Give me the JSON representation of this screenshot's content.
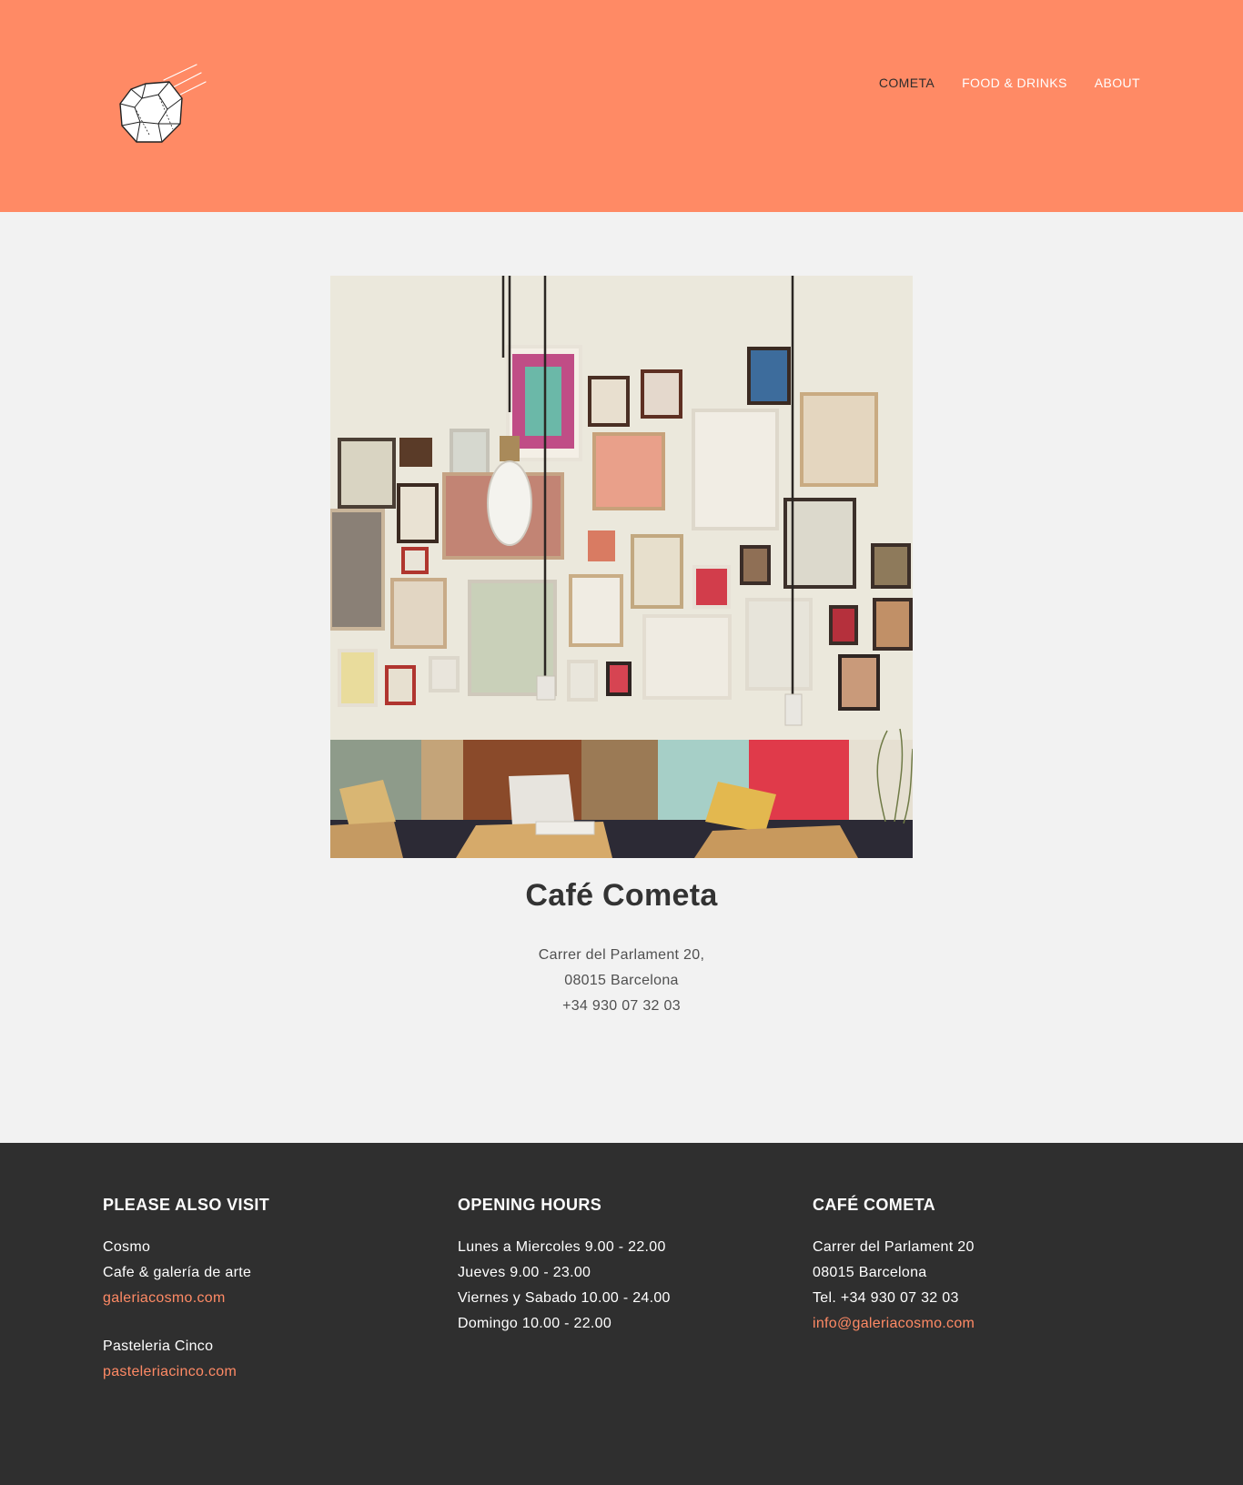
{
  "brand": {
    "logo_icon": "comet-icon",
    "accent": "#ff8a65",
    "dark": "#2f2f2f"
  },
  "nav": {
    "items": [
      {
        "label": "COMETA",
        "active": true
      },
      {
        "label": "FOOD & DRINKS",
        "active": false
      },
      {
        "label": "ABOUT",
        "active": false
      }
    ]
  },
  "venue": {
    "name": "Café Cometa",
    "address_line1": "Carrer del Parlament 20,",
    "address_line2": "08015 Barcelona",
    "phone": "+34 930 07 32 03"
  },
  "footer": {
    "visit": {
      "heading": "PLEASE ALSO VISIT",
      "place1_name": "Cosmo",
      "place1_desc": "Cafe & galería de arte",
      "place1_link": "galeriacosmo.com",
      "place2_name": "Pasteleria Cinco",
      "place2_link": "pasteleriacinco.com"
    },
    "hours": {
      "heading": "OPENING HOURS",
      "lines": [
        "Lunes a Miercoles 9.00 - 22.00",
        "Jueves 9.00 - 23.00",
        "Viernes y Sabado 10.00 - 24.00",
        "Domingo 10.00 - 22.00"
      ]
    },
    "contact": {
      "heading": "CAFÉ COMETA",
      "address_line1": "Carrer del Parlament 20",
      "address_line2": "08015 Barcelona",
      "phone": "Tel. +34 930 07 32 03",
      "email": "info@galeriacosmo.com"
    }
  }
}
